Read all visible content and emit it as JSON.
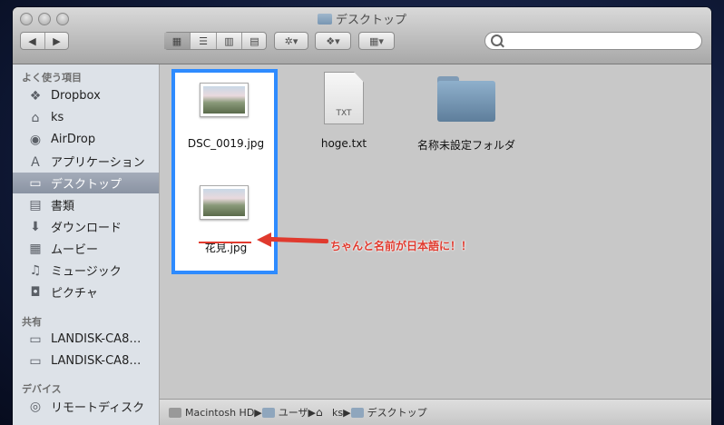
{
  "window": {
    "title": "デスクトップ"
  },
  "toolbar": {
    "back": "◀",
    "forward": "▶",
    "view_icon": "▦",
    "view_list": "☰",
    "view_column": "▥",
    "view_coverflow": "▤",
    "action": "✲▾",
    "dropbox": "❖▾",
    "arrange": "▦▾"
  },
  "search": {
    "placeholder": ""
  },
  "sidebar": {
    "favorites_header": "よく使う項目",
    "favorites": [
      {
        "label": "Dropbox",
        "icon": "dropbox-icon"
      },
      {
        "label": "ks",
        "icon": "home-icon"
      },
      {
        "label": "AirDrop",
        "icon": "airdrop-icon"
      },
      {
        "label": "アプリケーション",
        "icon": "applications-icon"
      },
      {
        "label": "デスクトップ",
        "icon": "desktop-icon",
        "selected": true
      },
      {
        "label": "書類",
        "icon": "documents-icon"
      },
      {
        "label": "ダウンロード",
        "icon": "downloads-icon"
      },
      {
        "label": "ムービー",
        "icon": "movies-icon"
      },
      {
        "label": "ミュージック",
        "icon": "music-icon"
      },
      {
        "label": "ピクチャ",
        "icon": "pictures-icon"
      }
    ],
    "shared_header": "共有",
    "shared": [
      {
        "label": "LANDISK-CA8…",
        "icon": "network-display-icon"
      },
      {
        "label": "LANDISK-CA8…",
        "icon": "network-display-icon"
      }
    ],
    "devices_header": "デバイス",
    "devices": [
      {
        "label": "リモートディスク",
        "icon": "remote-disc-icon"
      }
    ]
  },
  "files": [
    {
      "name": "DSC_0019.jpg",
      "kind": "image"
    },
    {
      "name": "hoge.txt",
      "kind": "text",
      "badge": "TXT"
    },
    {
      "name": "名称未設定フォルダ",
      "kind": "folder"
    },
    {
      "name": "花見.jpg",
      "kind": "image"
    }
  ],
  "annotation": {
    "text": "ちゃんと名前が日本語に！！",
    "color": "#e03a2e"
  },
  "statusbar": {
    "path": [
      "Macintosh HD",
      "ユーザ",
      "ks",
      "デスクトップ"
    ]
  },
  "colors": {
    "selection": "#2e8bff",
    "accent_red": "#e03a2e"
  }
}
